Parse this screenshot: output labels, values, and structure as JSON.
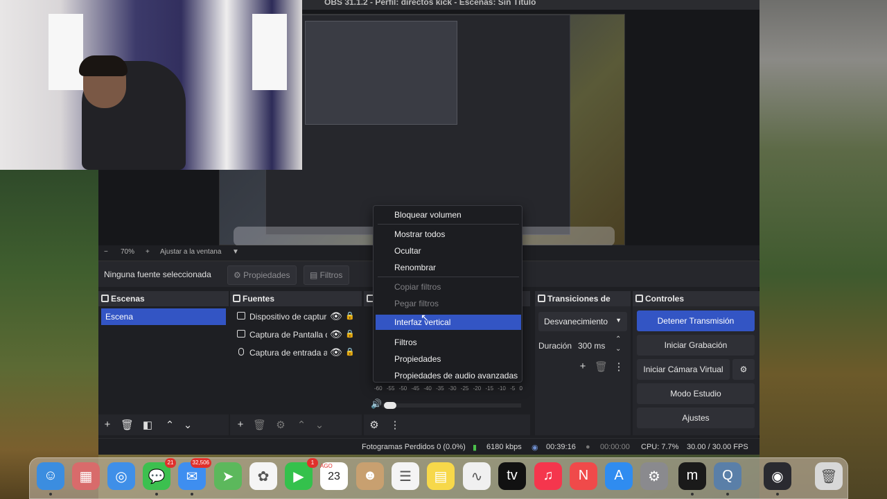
{
  "window": {
    "title": "OBS 31.1.2 - Perfil: directos kick - Escenas: Sin Título"
  },
  "preview_controls": {
    "zoom_out": "−",
    "zoom_value": "70%",
    "zoom_in": "+",
    "fit_label": "Ajustar a la ventana",
    "fit_dropdown": "▼"
  },
  "properties_bar": {
    "no_selection": "Ninguna fuente seleccionada",
    "properties_label": "Propiedades",
    "filters_label": "Filtros"
  },
  "scenes": {
    "title": "Escenas",
    "items": [
      "Escena"
    ]
  },
  "sources": {
    "title": "Fuentes",
    "items": [
      {
        "label": "Dispositivo de captura",
        "icon": "camera-icon"
      },
      {
        "label": "Captura de Pantalla de",
        "icon": "monitor-icon"
      },
      {
        "label": "Captura de entrada au",
        "icon": "microphone-icon"
      }
    ]
  },
  "context_menu": {
    "items": [
      {
        "label": "Bloquear volumen",
        "state": "normal"
      },
      {
        "label": "Mostrar todos",
        "state": "normal"
      },
      {
        "label": "Ocultar",
        "state": "normal"
      },
      {
        "label": "Renombrar",
        "state": "normal"
      },
      {
        "label": "Copiar filtros",
        "state": "disabled"
      },
      {
        "label": "Pegar filtros",
        "state": "disabled"
      },
      {
        "label": "Interfaz vertical",
        "state": "selected"
      },
      {
        "label": "Filtros",
        "state": "normal"
      },
      {
        "label": "Propiedades",
        "state": "normal"
      },
      {
        "label": "Propiedades de audio avanzadas",
        "state": "normal"
      }
    ]
  },
  "mixer": {
    "meter_ticks": [
      "-60",
      "-55",
      "-50",
      "-45",
      "-40",
      "-35",
      "-30",
      "-25",
      "-20",
      "-15",
      "-10",
      "-5",
      "0"
    ]
  },
  "transitions": {
    "title": "Transiciones de esc...",
    "selected": "Desvanecimiento",
    "duration_label": "Duración",
    "duration_value": "300 ms"
  },
  "controls": {
    "title": "Controles",
    "buttons": [
      "Detener Transmisión",
      "Iniciar Grabación",
      "Iniciar Cámara Virtual",
      "Modo Estudio",
      "Ajustes"
    ]
  },
  "status": {
    "dropped_frames": "Fotogramas Perdidos 0 (0.0%)",
    "bitrate": "6180 kbps",
    "stream_time": "00:39:16",
    "record_time": "00:00:00",
    "cpu": "CPU: 7.7%",
    "fps": "30.00 / 30.00 FPS"
  },
  "dock_apps": [
    {
      "name": "finder-icon",
      "color": "#3b8de0",
      "glyph": "☺"
    },
    {
      "name": "launchpad-icon",
      "color": "#d86b6b",
      "glyph": "▦"
    },
    {
      "name": "safari-icon",
      "color": "#3f8fe8",
      "glyph": "◎"
    },
    {
      "name": "messages-icon",
      "color": "#3cc04f",
      "glyph": "💬",
      "badge": "21"
    },
    {
      "name": "mail-icon",
      "color": "#3e8ef0",
      "glyph": "✉",
      "badge": "32,506"
    },
    {
      "name": "maps-icon",
      "color": "#5cb85c",
      "glyph": "➤"
    },
    {
      "name": "photos-icon",
      "color": "#f5f5f5",
      "glyph": "✿"
    },
    {
      "name": "facetime-icon",
      "color": "#34c14c",
      "glyph": "▶",
      "badge": "1"
    },
    {
      "name": "calendar-icon",
      "color": "#ffffff",
      "glyph": "23",
      "month": "AGO"
    },
    {
      "name": "contacts-icon",
      "color": "#c8a070",
      "glyph": "☻"
    },
    {
      "name": "reminders-icon",
      "color": "#f4f4f4",
      "glyph": "☰"
    },
    {
      "name": "notes-icon",
      "color": "#f7d84a",
      "glyph": "▤"
    },
    {
      "name": "freeform-icon",
      "color": "#f0f0f0",
      "glyph": "∿"
    },
    {
      "name": "appletv-icon",
      "color": "#111111",
      "glyph": "tv"
    },
    {
      "name": "music-icon",
      "color": "#f5364d",
      "glyph": "♫"
    },
    {
      "name": "news-icon",
      "color": "#f04a4a",
      "glyph": "N"
    },
    {
      "name": "appstore-icon",
      "color": "#2f8cf0",
      "glyph": "A"
    },
    {
      "name": "settings-icon",
      "color": "#8a8a8e",
      "glyph": "⚙"
    },
    {
      "name": "streaming-app-icon",
      "color": "#1a1a1a",
      "glyph": "m"
    },
    {
      "name": "quicktime-icon",
      "color": "#5a7fa8",
      "glyph": "Q"
    },
    {
      "name": "obs-icon",
      "color": "#2a2a30",
      "glyph": "◉"
    },
    {
      "name": "trash-icon",
      "color": "#d8d8d8",
      "glyph": "🗑"
    }
  ],
  "colors": {
    "accent": "#3355c4",
    "panel": "#25262b",
    "background": "#1e1f23"
  }
}
